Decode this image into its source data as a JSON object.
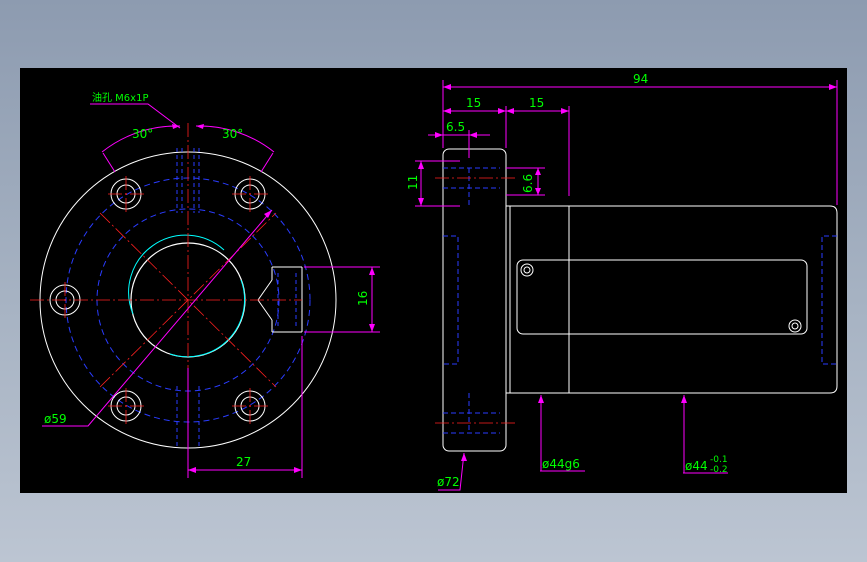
{
  "colors": {
    "background": "#000000",
    "outline": "#ffffff",
    "hidden": "#2a3cff",
    "center": "#ff2020",
    "dimension": "#ff00ff",
    "text": "#00ff00",
    "bore_highlight": "#00ffff"
  },
  "annotations": {
    "oil_hole": "油孔 M6x1P",
    "angle_left": "30°",
    "angle_right": "30°",
    "bolt_circle": "ø59",
    "bore_offset": "27",
    "port_height": "16",
    "overall_length": "94",
    "flange_thickness": "15",
    "second_offset": "15",
    "recess_width": "6.5",
    "counterbore_depth": "11",
    "counterbore_diameter": "6.6",
    "flange_diameter": "ø72",
    "pilot_diameter": "ø44g6",
    "body_diameter_base": "ø44",
    "body_tol_upper": "-0.1",
    "body_tol_lower": "-0.2"
  }
}
